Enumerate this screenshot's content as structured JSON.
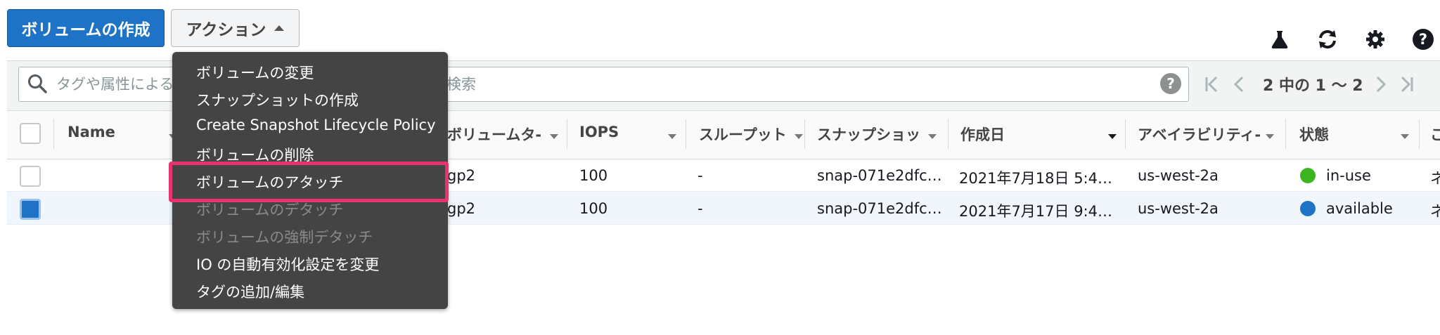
{
  "toolbar": {
    "create_label": "ボリュームの作成",
    "actions_label": "アクション"
  },
  "search": {
    "placeholder_left": "タグや属性による",
    "placeholder_right": "検索"
  },
  "pagination": {
    "text": "2 中の 1 〜 2"
  },
  "columns": [
    "Name",
    "ボリュームタ-",
    "IOPS",
    "スループット",
    "スナップショッ",
    "作成日",
    "アベイラビリティ-",
    "状態",
    "こ"
  ],
  "rows": [
    {
      "selected": false,
      "type": "gp2",
      "iops": "100",
      "throughput": "-",
      "snapshot": "snap-071e2dfc…",
      "created": "2021年7月18日 5:4…",
      "az": "us-west-2a",
      "state": "in-use",
      "state_color": "#3cb521",
      "extra": "ネ"
    },
    {
      "selected": true,
      "type": "gp2",
      "iops": "100",
      "throughput": "-",
      "snapshot": "snap-071e2dfc…",
      "created": "2021年7月17日 9:4…",
      "az": "us-west-2a",
      "state": "available",
      "state_color": "#1f73c7",
      "extra": "ネ"
    }
  ],
  "menu": {
    "items": [
      {
        "label": "ボリュームの変更",
        "disabled": false
      },
      {
        "label": "スナップショットの作成",
        "disabled": false
      },
      {
        "label": "Create Snapshot Lifecycle Policy",
        "disabled": false
      },
      {
        "label": "ボリュームの削除",
        "disabled": false
      },
      {
        "label": "ボリュームのアタッチ",
        "disabled": false,
        "highlighted": true
      },
      {
        "label": "ボリュームのデタッチ",
        "disabled": true
      },
      {
        "label": "ボリュームの強制デタッチ",
        "disabled": true
      },
      {
        "label": "IO の自動有効化設定を変更",
        "disabled": false
      },
      {
        "label": "タグの追加/編集",
        "disabled": false
      }
    ]
  },
  "colors": {
    "primary": "#1f73c7",
    "highlight_border": "#e8336f",
    "menu_bg": "#444444"
  },
  "icons": [
    "flask-icon",
    "refresh-icon",
    "gear-icon",
    "help-icon"
  ]
}
